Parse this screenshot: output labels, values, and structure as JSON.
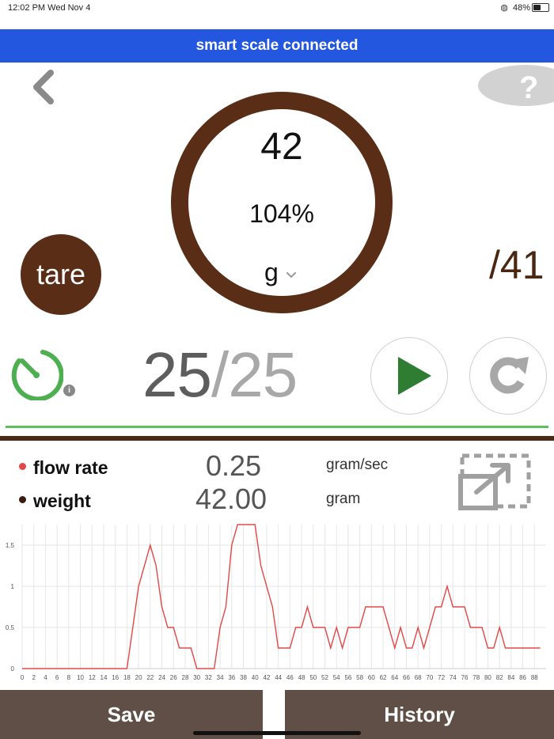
{
  "status_bar": {
    "time": "12:02 PM  Wed Nov 4",
    "battery": "48%",
    "battery_level": 0.48
  },
  "banner": {
    "text": "smart scale connected"
  },
  "scale": {
    "value": "42",
    "percent": "104%",
    "unit": "g"
  },
  "tare": {
    "label": "tare"
  },
  "target": {
    "label": "/41"
  },
  "timer": {
    "elapsed": "25",
    "total": "/25",
    "info": "i"
  },
  "metrics": {
    "flow": {
      "label": "flow rate",
      "value": "0.25",
      "unit": "gram/sec"
    },
    "weight": {
      "label": "weight",
      "value": "42.00",
      "unit": "gram"
    }
  },
  "icons": {
    "back": "chevron-left-icon",
    "help": "question-icon",
    "timer": "stopwatch-icon",
    "play": "play-icon",
    "reset": "refresh-icon",
    "expand": "expand-icon",
    "unit": "chevron-down-icon"
  },
  "colors": {
    "brown": "#5a2e16",
    "banner": "#2357e0",
    "green": "#5fbf5f",
    "play": "#2e7d32",
    "flow_line": "#e34848",
    "button_bar": "#5f4f46"
  },
  "chart_data": {
    "type": "line",
    "x": [
      0,
      2,
      4,
      6,
      8,
      10,
      12,
      14,
      16,
      18,
      19,
      20,
      21,
      22,
      23,
      24,
      25,
      26,
      27,
      28,
      29,
      30,
      31,
      32,
      33,
      34,
      35,
      36,
      37,
      38,
      39,
      40,
      41,
      42,
      43,
      44,
      45,
      46,
      47,
      48,
      49,
      50,
      51,
      52,
      53,
      54,
      55,
      56,
      57,
      58,
      59,
      60,
      61,
      62,
      63,
      64,
      65,
      66,
      67,
      68,
      69,
      70,
      71,
      72,
      73,
      74,
      75,
      76,
      77,
      78,
      79,
      80,
      81,
      82,
      83,
      84,
      85,
      86,
      87,
      88,
      89
    ],
    "series": [
      {
        "values": [
          0,
          0,
          0,
          0,
          0,
          0,
          0,
          0,
          0,
          0,
          0.5,
          1,
          1.25,
          1.5,
          1.25,
          0.75,
          0.5,
          0.5,
          0.25,
          0.25,
          0.25,
          0,
          0,
          0,
          0,
          0.5,
          0.75,
          1.5,
          1.75,
          1.75,
          1.75,
          1.75,
          1.25,
          1,
          0.75,
          0.25,
          0.25,
          0.25,
          0.5,
          0.5,
          0.75,
          0.5,
          0.5,
          0.5,
          0.25,
          0.5,
          0.25,
          0.5,
          0.5,
          0.5,
          0.75,
          0.75,
          0.75,
          0.75,
          0.5,
          0.25,
          0.5,
          0.25,
          0.25,
          0.5,
          0.25,
          0.5,
          0.75,
          0.75,
          1,
          0.75,
          0.75,
          0.75,
          0.5,
          0.5,
          0.5,
          0.25,
          0.25,
          0.5,
          0.25,
          0.25,
          0.25,
          0.25,
          0.25,
          0.25,
          0.25
        ]
      }
    ],
    "xticks": [
      0,
      2,
      4,
      6,
      8,
      10,
      12,
      14,
      16,
      18,
      20,
      22,
      24,
      26,
      28,
      30,
      32,
      34,
      36,
      38,
      40,
      42,
      44,
      46,
      48,
      50,
      52,
      54,
      56,
      58,
      60,
      62,
      64,
      66,
      68,
      70,
      72,
      74,
      76,
      78,
      80,
      82,
      84,
      86,
      88
    ],
    "yticks": [
      0,
      0.5,
      1,
      1.5
    ],
    "xlim": [
      0,
      90
    ],
    "ylim": [
      0,
      1.75
    ],
    "grid": true
  },
  "buttons": {
    "save": "Save",
    "history": "History"
  }
}
